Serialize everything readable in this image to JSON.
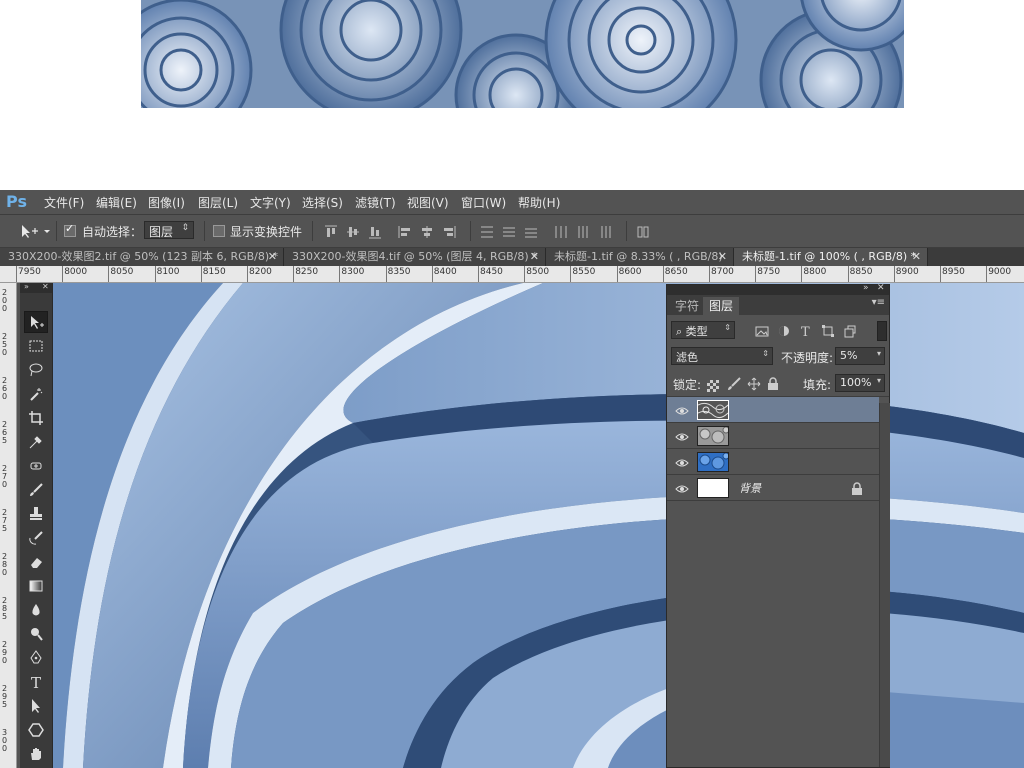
{
  "menubar": {
    "logo": "Ps",
    "items": [
      "文件(F)",
      "编辑(E)",
      "图像(I)",
      "图层(L)",
      "文字(Y)",
      "选择(S)",
      "滤镜(T)",
      "视图(V)",
      "窗口(W)",
      "帮助(H)"
    ]
  },
  "options": {
    "auto_select_label": "自动选择：",
    "auto_select_checked": true,
    "auto_select_target": "图层",
    "show_transform_label": "显示变换控件"
  },
  "tabs": [
    {
      "label": "330X200-效果图2.tif @ 50% (123 副本 6, RGB/8) *",
      "active": false
    },
    {
      "label": "330X200-效果图4.tif @ 50% (图层 4, RGB/8) *",
      "active": false
    },
    {
      "label": "未标题-1.tif @ 8.33% ( , RGB/8)",
      "active": false
    },
    {
      "label": "未标题-1.tif @ 100% ( , RGB/8) *",
      "active": true
    }
  ],
  "ruler_top": [
    "7950",
    "8000",
    "8050",
    "8100",
    "8150",
    "8200",
    "8250",
    "8300",
    "8350",
    "8400",
    "8450",
    "8500",
    "8550",
    "8600",
    "8650",
    "8700",
    "8750",
    "8800",
    "8850",
    "8900",
    "8950",
    "9000"
  ],
  "ruler_left": [
    "2\n0\n0",
    "2\n5\n0",
    "2\n6\n0",
    "2\n6\n5",
    "2\n7\n0",
    "2\n7\n5",
    "2\n8\n0",
    "2\n8\n5",
    "2\n9\n0",
    "2\n9\n5",
    "3\n0\n0"
  ],
  "panel": {
    "tabs": [
      "字符",
      "图层"
    ],
    "active_tab": "图层",
    "filter_label": "类型",
    "blend_mode": "滤色",
    "opacity_label": "不透明度:",
    "opacity_value": "5%",
    "lock_label": "锁定:",
    "fill_label": "填充:",
    "fill_value": "100%",
    "layers": [
      {
        "name": "",
        "selected": true,
        "thumb": "texture-dark"
      },
      {
        "name": "",
        "selected": false,
        "thumb": "texture-gray"
      },
      {
        "name": "",
        "selected": false,
        "thumb": "texture-blue"
      },
      {
        "name": "背景",
        "selected": false,
        "thumb": "white",
        "locked": true
      }
    ]
  },
  "colors": {
    "ps_blue": "#6fb2e9",
    "panel_bg": "#535353",
    "selected_layer": "#6e7e95",
    "canvas_blue": "#6f90bb"
  }
}
